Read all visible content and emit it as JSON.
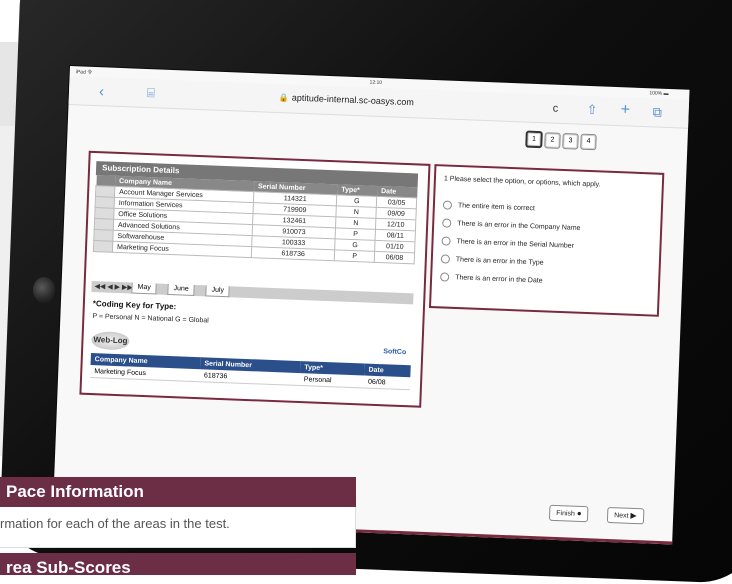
{
  "statusbar": {
    "left": "iPad 令",
    "time": "12:10",
    "right": "100% ▬"
  },
  "browser": {
    "url": "aptitude-internal.sc-oasys.com",
    "back": "‹",
    "book": "⌸",
    "reload": "c",
    "share": "⇧",
    "add": "+",
    "tabs": "⧉"
  },
  "pages": [
    "1",
    "2",
    "3",
    "4"
  ],
  "subscription": {
    "title": "Subscription Details",
    "headers": [
      "Company Name",
      "Serial Number",
      "Type*",
      "Date"
    ],
    "rows": [
      [
        "Account Manager Services",
        "114321",
        "G",
        "03/05"
      ],
      [
        "Information Services",
        "719909",
        "N",
        "09/09"
      ],
      [
        "Office Solutions",
        "132461",
        "N",
        "12/10"
      ],
      [
        "Advanced Solutions",
        "910073",
        "P",
        "08/11"
      ],
      [
        "Softwarehouse",
        "100333",
        "G",
        "01/10"
      ],
      [
        "Marketing Focus",
        "618736",
        "P",
        "06/08"
      ]
    ],
    "sheet_tabs": [
      "May",
      "June",
      "July"
    ],
    "tab_arrows": "◀◀ ◀ ▶ ▶▶"
  },
  "coding": {
    "title": "*Coding Key for Type:",
    "legend": "P = Personal   N = National   G = Global"
  },
  "weblog": {
    "logo": "Web-Log",
    "brand": "SoftCo",
    "headers": [
      "Company Name",
      "Serial Number",
      "Type*",
      "Date"
    ],
    "row": [
      "Marketing Focus",
      "618736",
      "Personal",
      "06/08"
    ]
  },
  "question": {
    "prompt": "1  Please select the option, or options, which apply.",
    "options": [
      "The entire item is correct",
      "There is an error in the Company Name",
      "There is an error in the Serial Number",
      "There is an error in the Type",
      "There is an error in the Date"
    ]
  },
  "buttons": {
    "finish": "Finish",
    "next": "Next"
  },
  "overlay": {
    "title1": "Pace Information",
    "desc1": "rmation for each of the areas in the test.",
    "title2": "rea Sub-Scores"
  }
}
